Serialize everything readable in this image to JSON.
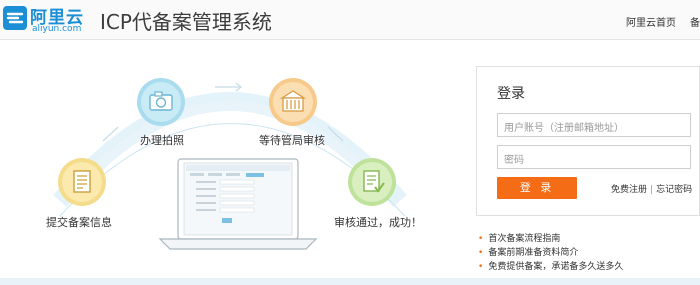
{
  "header": {
    "logo_cn": "阿里云",
    "logo_en": "aliyun.com",
    "title": "ICP代备案管理系统",
    "nav": [
      "阿里云首页",
      "备案"
    ]
  },
  "steps": [
    {
      "label": "提交备案信息",
      "icon": "document-icon",
      "color": "#f5dc8a"
    },
    {
      "label": "办理拍照",
      "icon": "camera-icon",
      "color": "#a9dcef"
    },
    {
      "label": "等待管局审核",
      "icon": "building-icon",
      "color": "#f7c98a"
    },
    {
      "label": "审核通过，成功！",
      "icon": "approved-document-icon",
      "color": "#bfe29a"
    }
  ],
  "login": {
    "title": "登录",
    "username_placeholder": "用户账号（注册邮箱地址）",
    "password_placeholder": "密码",
    "login_button": "登 录",
    "register_link": "免费注册",
    "separator": "|",
    "forgot_link": "忘记密码"
  },
  "links": [
    "首次备案流程指南",
    "备案前期准备资料简介",
    "免费提供备案，承诺备多久送多久"
  ],
  "colors": {
    "brand": "#1a8fd6",
    "accent": "#f46c15"
  }
}
